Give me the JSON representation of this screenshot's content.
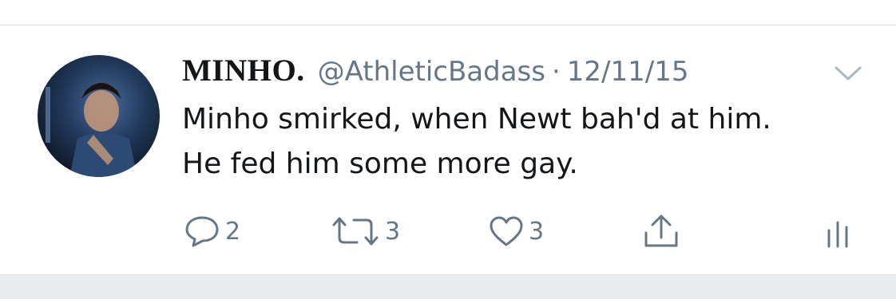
{
  "tweet": {
    "display_name": "MINHO.",
    "handle": "@AthleticBadass",
    "separator": "·",
    "date": "12/11/15",
    "text_lines": [
      "Minho smirked, when Newt bah'd at him.",
      "He fed him some more gay."
    ]
  },
  "actions": {
    "reply_count": "2",
    "retweet_count": "3",
    "like_count": "3",
    "icons": [
      "reply-icon",
      "retweet-icon",
      "heart-icon",
      "share-icon",
      "analytics-icon"
    ]
  },
  "colors": {
    "text": "#14171a",
    "secondary": "#657786",
    "divider": "#d8dde2",
    "background_strip": "#e8ecef"
  }
}
